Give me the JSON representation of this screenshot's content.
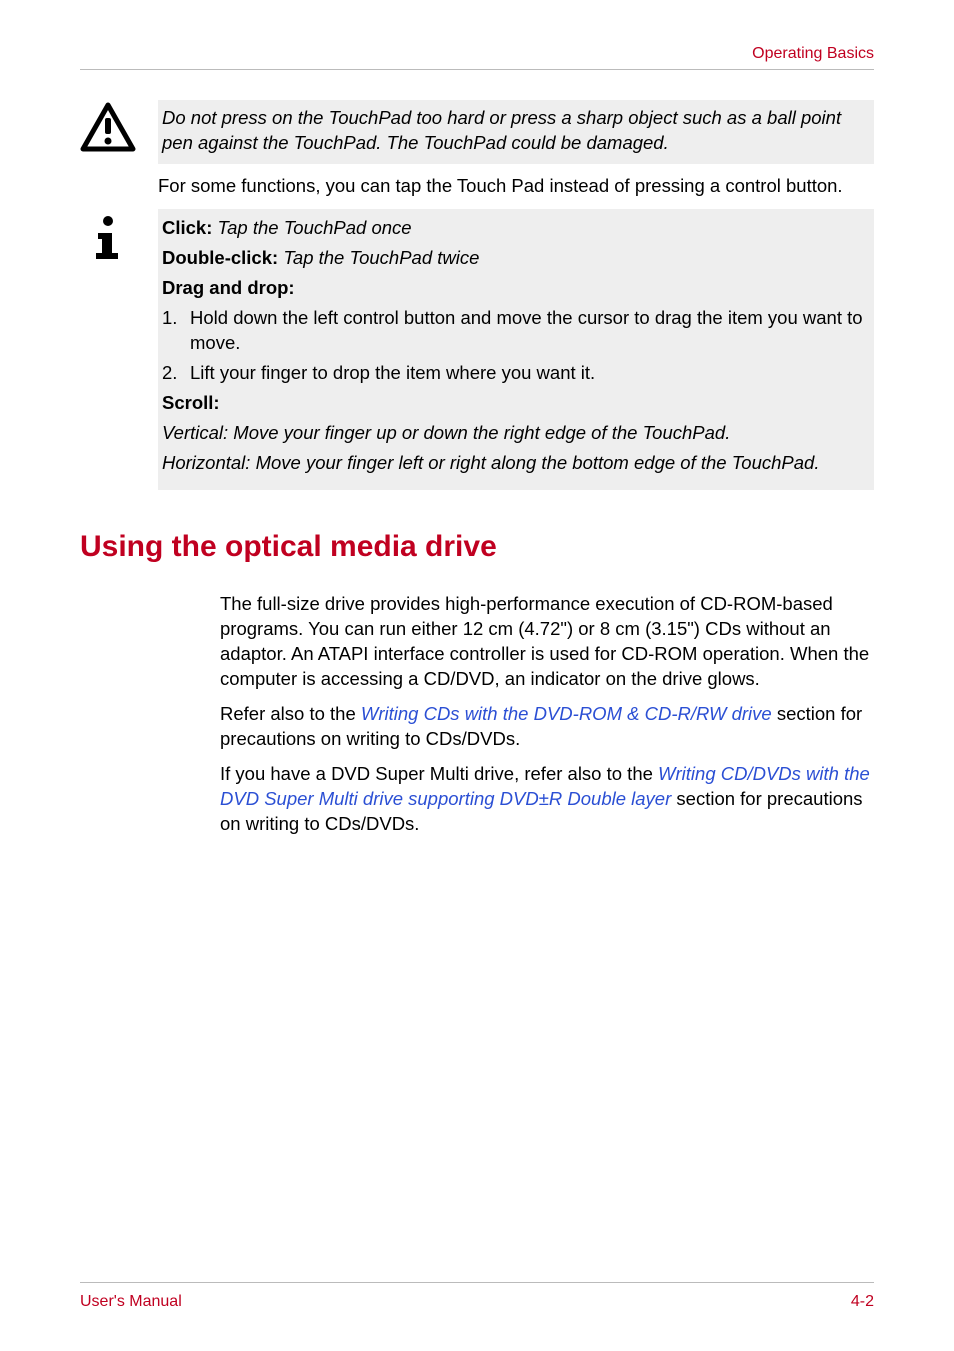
{
  "header": {
    "category": "Operating Basics"
  },
  "warning_box": {
    "text": "Do not press on the TouchPad too hard or press a sharp object such as a ball point pen against the TouchPad. The TouchPad could be damaged."
  },
  "intro_text": "For some functions, you can tap the Touch Pad instead of pressing a control button.",
  "info_box": {
    "click_label": "Click:",
    "click_desc": "Tap the TouchPad once",
    "double_click_label": "Double-click:",
    "double_click_desc": "Tap the TouchPad twice",
    "drag_drop_label": "Drag and drop:",
    "steps": [
      "Hold down the left control button and move the cursor to drag the item you want to move.",
      "Lift your finger to drop the item where you want it."
    ],
    "scroll_label": "Scroll:",
    "scroll_vertical": "Vertical: Move your finger up or down the right edge of the TouchPad.",
    "scroll_horizontal": "Horizontal: Move your finger left or right along the bottom edge of the TouchPad."
  },
  "section": {
    "title": "Using the optical media drive",
    "para1": "The full-size drive provides high-performance execution of CD-ROM-based programs. You can run either 12 cm (4.72\") or 8 cm (3.15\") CDs without an adaptor. An ATAPI interface controller is used for CD-ROM operation. When the computer is accessing a CD/DVD, an indicator on the drive glows.",
    "para2_before": "Refer also to the ",
    "para2_link": "Writing CDs with the DVD-ROM & CD-R/RW drive",
    "para2_after": " section for precautions on writing to CDs/DVDs.",
    "para3_before": "If you have a DVD Super Multi drive, refer also to the ",
    "para3_link": "Writing CD/DVDs with the DVD Super Multi drive supporting DVD±R Double layer",
    "para3_after": " section for precautions on writing to CDs/DVDs."
  },
  "footer": {
    "left": "User's Manual",
    "right": "4-2"
  }
}
